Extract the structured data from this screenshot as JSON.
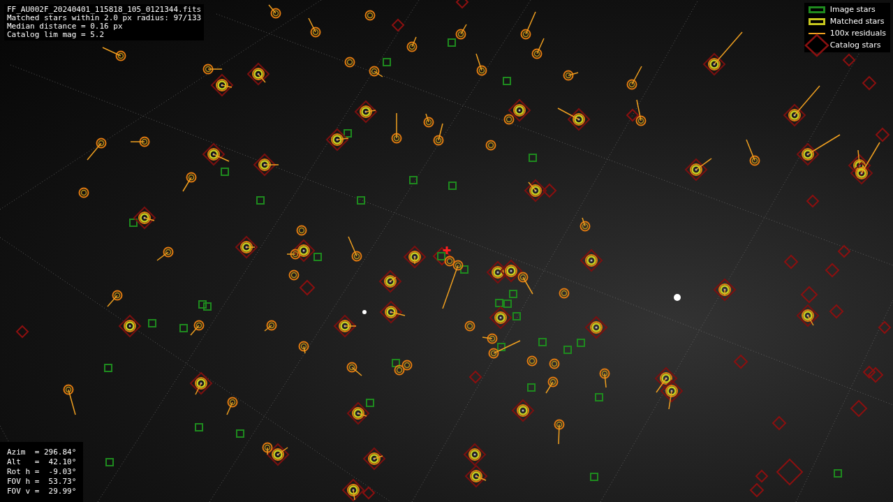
{
  "header_lines": [
    "FF_AU002F_20240401_115818_105_0121344.fits",
    "Matched stars within 2.0 px radius: 97/133",
    "Median distance = 0.16 px",
    "Catalog lim mag = 5.2"
  ],
  "legend": [
    {
      "kind": "image",
      "label": "Image stars"
    },
    {
      "kind": "matched",
      "label": "Matched stars"
    },
    {
      "kind": "residual",
      "label": "100x residuals"
    },
    {
      "kind": "catalog",
      "label": "Catalog stars"
    }
  ],
  "pointing_lines": [
    "Azim  = 296.84°",
    "Alt   =  42.10°",
    "Rot h =  -9.03°",
    "FOV h =  53.73°",
    "FOV v =  29.99°"
  ]
}
